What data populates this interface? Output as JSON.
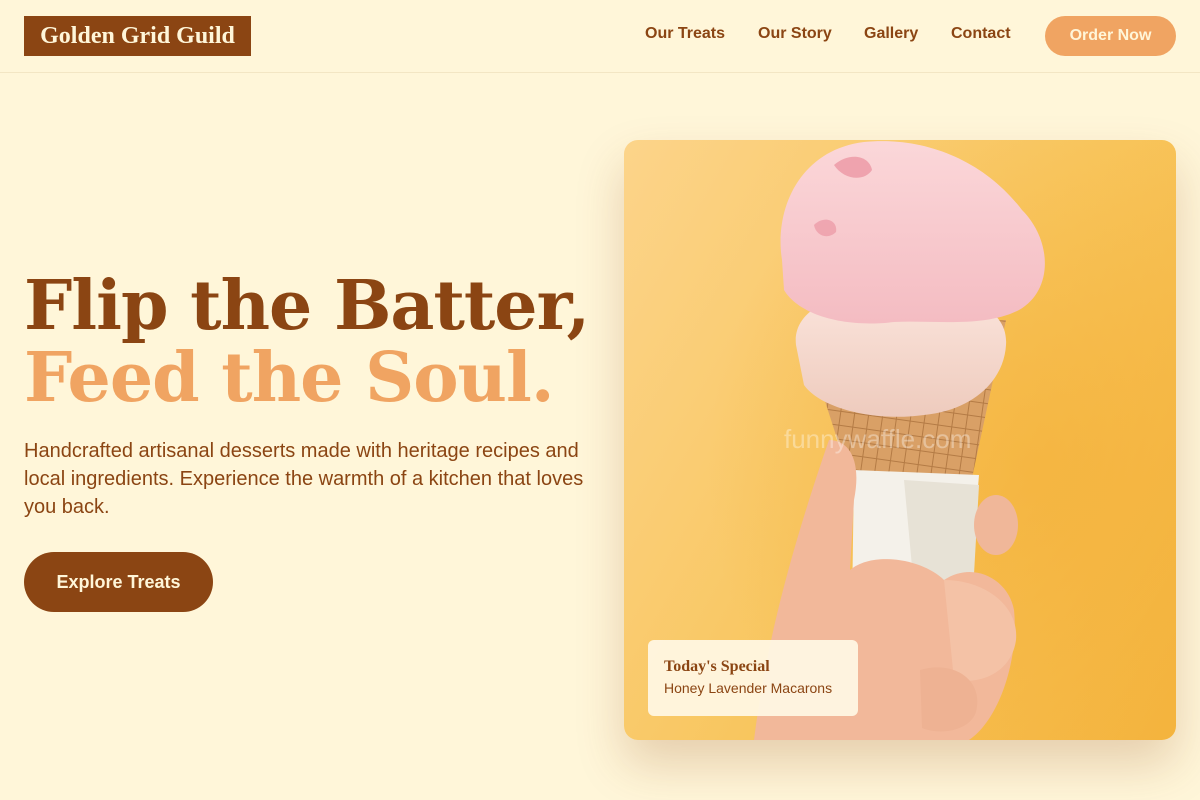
{
  "brand": {
    "name": "Golden Grid Guild"
  },
  "nav": {
    "items": [
      {
        "label": "Our Treats"
      },
      {
        "label": "Our Story"
      },
      {
        "label": "Gallery"
      },
      {
        "label": "Contact"
      }
    ],
    "cta_label": "Order Now"
  },
  "hero": {
    "headline_line1": "Flip the Batter,",
    "headline_line2": "Feed the Soul.",
    "description": "Handcrafted artisanal desserts made with heritage recipes and local ingredients. Experience the warmth of a kitchen that loves you back.",
    "cta_label": "Explore Treats",
    "image_watermark": "funnywaffle.com",
    "special": {
      "title": "Today's Special",
      "item": "Honey Lavender Macarons"
    }
  },
  "colors": {
    "background": "#fff6d9",
    "primary_brown": "#8b4513",
    "accent_orange": "#f0a462",
    "image_background": "#f8c55c"
  },
  "icons": [
    "ice-cream-cone-photo"
  ]
}
